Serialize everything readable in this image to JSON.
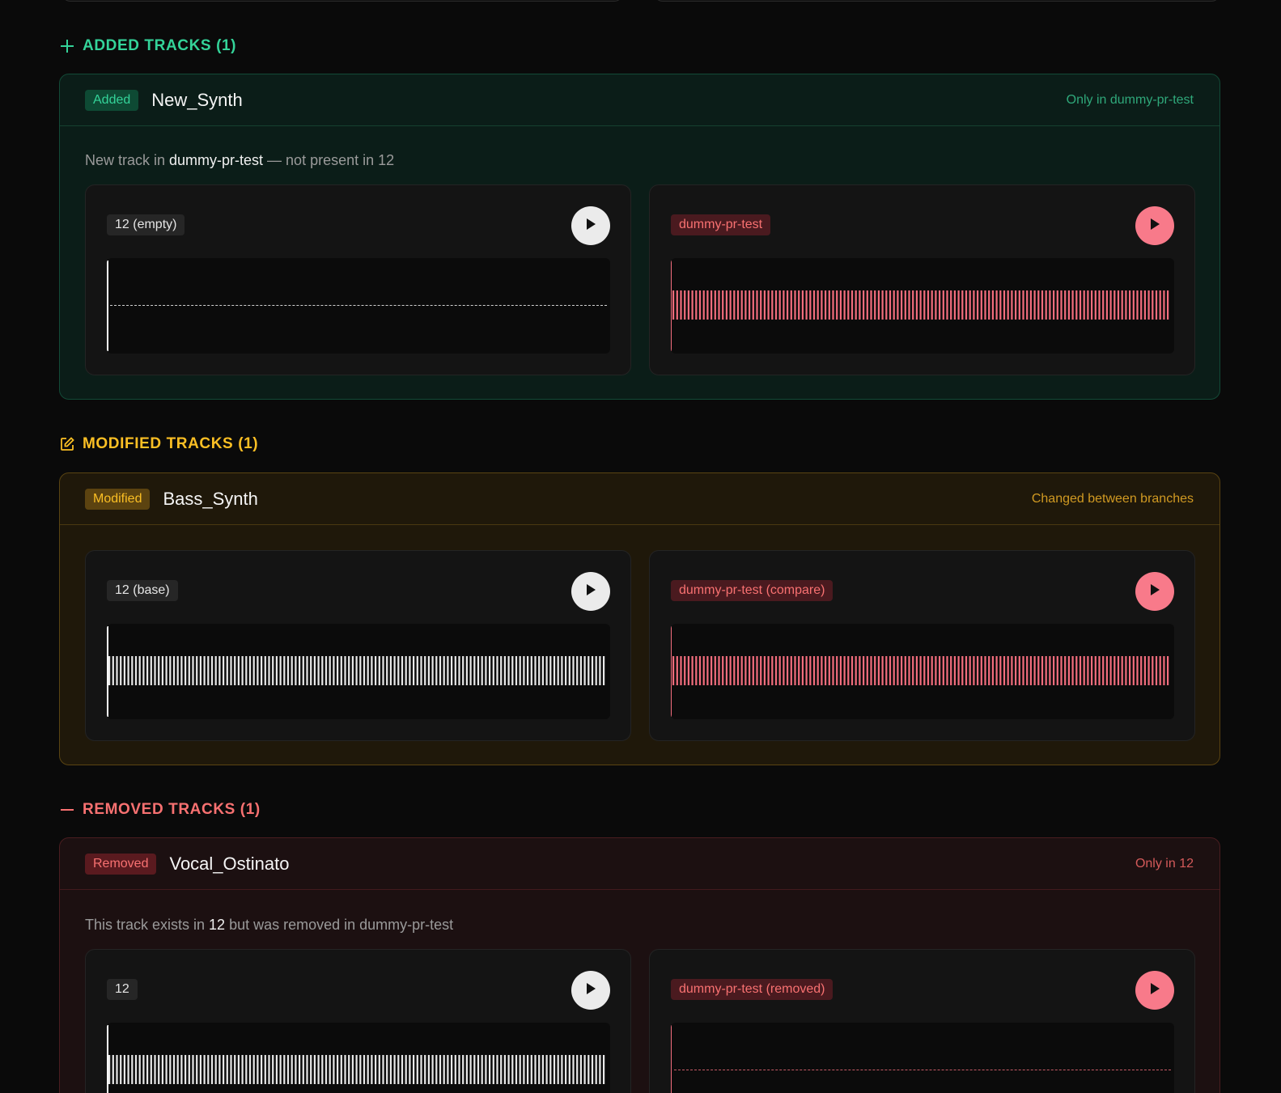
{
  "colors": {
    "added": "#34d399",
    "modified": "#fbbf24",
    "removed": "#f87171",
    "base_wave": "#e8e8e8",
    "compare_wave": "#f26d7d",
    "compare_play": "#f87a8a",
    "base_play": "#ebebeb"
  },
  "added": {
    "heading": "ADDED TRACKS (1)",
    "icon": "plus-icon",
    "track": {
      "badge": "Added",
      "name": "New_Synth",
      "note": "Only in dummy-pr-test",
      "desc_pre": "New track in ",
      "desc_em": "dummy-pr-test",
      "desc_post": " — not present in 12",
      "left_label": "12 (empty)",
      "right_label": "dummy-pr-test"
    }
  },
  "modified": {
    "heading": "MODIFIED TRACKS (1)",
    "icon": "edit-icon",
    "track": {
      "badge": "Modified",
      "name": "Bass_Synth",
      "note": "Changed between branches",
      "left_label": "12 (base)",
      "right_label": "dummy-pr-test (compare)"
    }
  },
  "removed": {
    "heading": "REMOVED TRACKS (1)",
    "icon": "minus-icon",
    "track": {
      "badge": "Removed",
      "name": "Vocal_Ostinato",
      "note": "Only in 12",
      "desc_pre": "This track exists in ",
      "desc_em": "12",
      "desc_post": " but was removed in dummy-pr-test",
      "left_label": "12",
      "right_label": "dummy-pr-test (removed)"
    }
  }
}
